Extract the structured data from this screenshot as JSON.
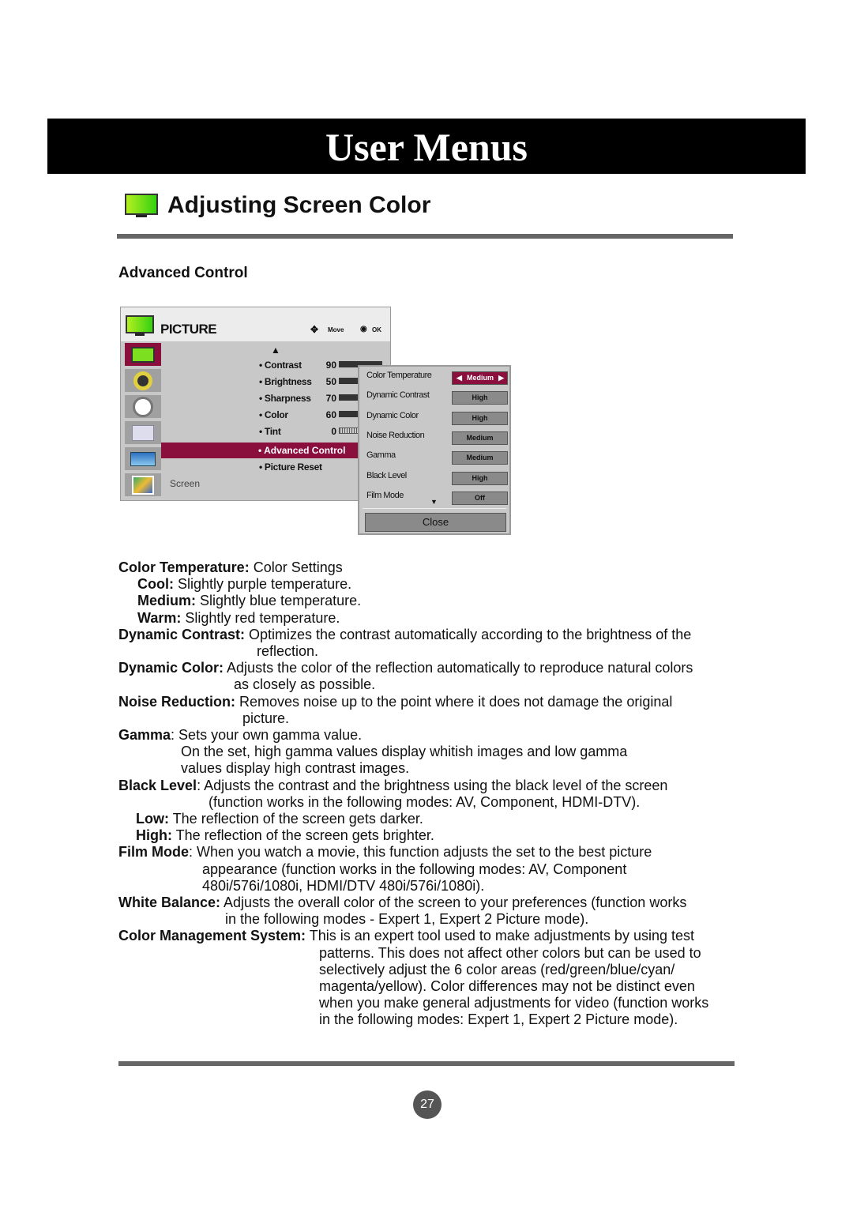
{
  "banner": "User Menus",
  "section_title": "Adjusting Screen Color",
  "subtitle": "Advanced Control",
  "menu": {
    "title": "PICTURE",
    "move": "Move",
    "ok": "OK",
    "items": [
      {
        "label": "• Contrast",
        "value": "90"
      },
      {
        "label": "• Brightness",
        "value": "50"
      },
      {
        "label": "• Sharpness",
        "value": "70"
      },
      {
        "label": "• Color",
        "value": "60"
      },
      {
        "label": "• Tint",
        "value": "0"
      }
    ],
    "advanced": "• Advanced Control",
    "reset": "• Picture Reset",
    "screen": "Screen",
    "sidebar_icons": [
      "picture-icon",
      "speaker-icon",
      "clock-icon",
      "toolbox-icon",
      "tile-icon",
      "media-icon"
    ]
  },
  "popup": {
    "rows": [
      {
        "label": "Color Temperature",
        "value": "Medium"
      },
      {
        "label": "Dynamic Contrast",
        "value": "High"
      },
      {
        "label": "Dynamic Color",
        "value": "High"
      },
      {
        "label": "Noise Reduction",
        "value": "Medium"
      },
      {
        "label": "Gamma",
        "value": "Medium"
      },
      {
        "label": "Black Level",
        "value": "High"
      },
      {
        "label": "Film Mode",
        "value": "Off"
      }
    ],
    "close": "Close"
  },
  "desc": [
    {
      "term": "Color Temperature:",
      "text": " Color Settings"
    },
    {
      "term": "Cool:",
      "text": " Slightly purple temperature."
    },
    {
      "term": "Medium:",
      "text": " Slightly blue temperature."
    },
    {
      "term": "Warm:",
      "text": " Slightly red temperature."
    },
    {
      "term": "Dynamic Contrast:",
      "text": " Optimizes the contrast automatically according to the brightness of the"
    },
    {
      "term": "",
      "text": "reflection."
    },
    {
      "term": "Dynamic Color:",
      "text": " Adjusts the color of the reflection automatically to reproduce natural colors"
    },
    {
      "term": "",
      "text": "as closely as possible."
    },
    {
      "term": "Noise Reduction:",
      "text": " Removes noise up to the point where it does not damage the original"
    },
    {
      "term": "",
      "text": "picture."
    },
    {
      "term": "Gamma",
      "text": ": Sets your own gamma value."
    },
    {
      "term": "",
      "text": "On the set, high gamma values display whitish images and low gamma"
    },
    {
      "term": "",
      "text": "values display high contrast images."
    },
    {
      "term": "Black Level",
      "text": ": Adjusts the contrast and the brightness using the black level of the screen"
    },
    {
      "term": "",
      "text": "(function works in the following modes: AV, Component, HDMI-DTV)."
    },
    {
      "term": "Low:",
      "text": " The reflection of the screen gets darker."
    },
    {
      "term": "High:",
      "text": " The reflection of the screen gets brighter."
    },
    {
      "term": "Film Mode",
      "text": ": When you watch a movie, this function adjusts the set to the best picture"
    },
    {
      "term": "",
      "text": "appearance (function works in the following modes: AV, Component"
    },
    {
      "term": "",
      "text": "480i/576i/1080i, HDMI/DTV 480i/576i/1080i)."
    },
    {
      "term": "White Balance:",
      "text": " Adjusts the overall color of the screen to your preferences (function works"
    },
    {
      "term": "",
      "text": "in the following modes - Expert 1, Expert 2 Picture mode)."
    },
    {
      "term": "Color Management System:",
      "text": " This is an expert tool used to make adjustments by using test"
    },
    {
      "term": "",
      "text": "patterns. This does not affect other colors but can be used to"
    },
    {
      "term": "",
      "text": "selectively adjust the 6 color areas (red/green/blue/cyan/"
    },
    {
      "term": "",
      "text": "magenta/yellow). Color differences may not be distinct even"
    },
    {
      "term": "",
      "text": "when you make general adjustments for video (function works"
    },
    {
      "term": "",
      "text": "in the following modes: Expert 1, Expert 2 Picture mode)."
    }
  ],
  "page_number": "27",
  "colors": {
    "highlight": "#8b0f3c",
    "banner": "#000000",
    "rule": "#666666"
  }
}
